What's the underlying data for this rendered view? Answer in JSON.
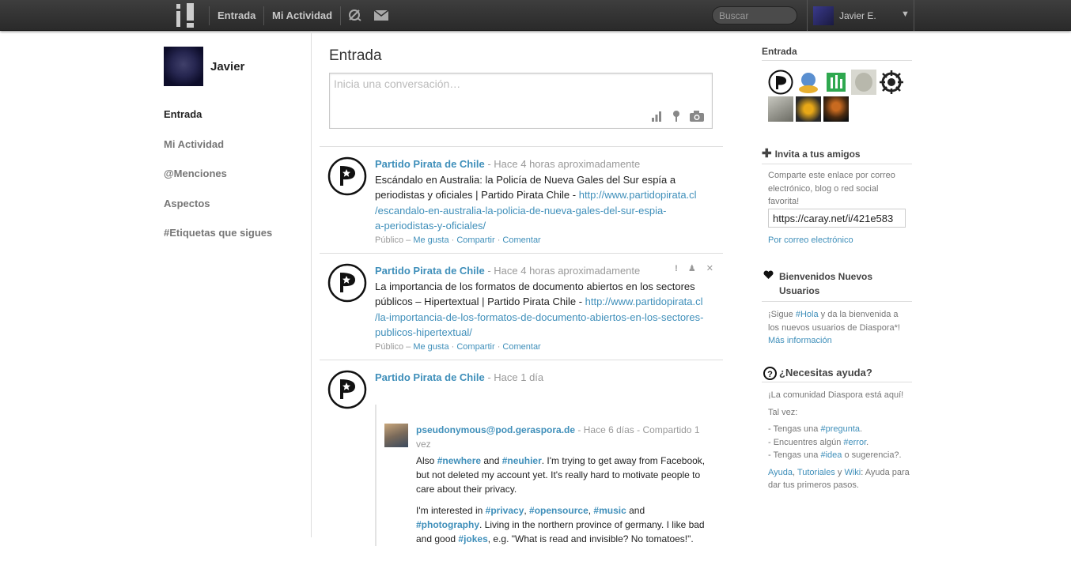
{
  "topbar": {
    "nav_home": "Entrada",
    "nav_activity": "Mi Actividad",
    "search_placeholder": "Buscar",
    "user_name": "Javier E."
  },
  "sidebar": {
    "name": "Javier",
    "items": [
      {
        "label": "Entrada",
        "active": true
      },
      {
        "label": "Mi Actividad"
      },
      {
        "label": "@Menciones"
      },
      {
        "label": "Aspectos"
      },
      {
        "label": "#Etiquetas que sigues"
      }
    ]
  },
  "main": {
    "title": "Entrada",
    "publisher_placeholder": "Inicia una conversación…",
    "posts": [
      {
        "author": "Partido Pirata de Chile",
        "time": "- Hace 4 horas aproximadamente",
        "text": "Escándalo en Australia: la Policía de Nueva Gales del Sur espía a periodistas y oficiales | Partido Pirata Chile - ",
        "link_l1": "http://www.partidopirata.cl",
        "link_l2": "/escandalo-en-australia-la-policia-de-nueva-gales-del-sur-espia-",
        "link_l3": "a-periodistas-y-oficiales/",
        "visibility": "Público",
        "like": "Me gusta",
        "share": "Compartir",
        "comment": "Comentar"
      },
      {
        "author": "Partido Pirata de Chile",
        "time": "- Hace 4 horas aproximadamente",
        "text": "La importancia de los formatos de documento abiertos en los sectores públicos – Hipertextual | Partido Pirata Chile - ",
        "link_l1": "http://www.partidopirata.cl",
        "link_l2": "/la-importancia-de-los-formatos-de-documento-abiertos-en-los-sectores-",
        "link_l3": "publicos-hipertextual/",
        "visibility": "Público",
        "like": "Me gusta",
        "share": "Compartir",
        "comment": "Comentar"
      },
      {
        "author": "Partido Pirata de Chile",
        "time": "- Hace 1 día",
        "reshare": {
          "author": "pseudonymous@pod.geraspora.de",
          "time": "- Hace 6 días - Compartido 1 vez",
          "p1_a": "Also ",
          "tag_newhere": "#newhere",
          "p1_b": " and ",
          "tag_neuhier": "#neuhier",
          "p1_c": ". I'm trying to get away from Facebook, but not deleted my account yet. It's really hard to motivate people to care about their privacy.",
          "p2_a": "I'm interested in ",
          "tag_privacy": "#privacy",
          "tag_opensource": "#opensource",
          "tag_music": "#music",
          "p2_and": " and ",
          "tag_photography": "#photography",
          "p2_b": ". Living in the northern province of germany. I like bad and good ",
          "tag_jokes": "#jokes",
          "p2_c": ", e.g. \"What is read and invisible? No tomatoes!\"."
        }
      }
    ]
  },
  "right": {
    "aspect_title": "Entrada",
    "invite_title": "Invita a tus amigos",
    "invite_text": "Comparte este enlace por correo electrónico, blog o red social favorita!",
    "invite_link": "https://caray.net/i/421e583",
    "invite_email": "Por correo electrónico",
    "welcome_title": "Bienvenidos Nuevos Usuarios",
    "welcome_a": "¡Sigue ",
    "welcome_tag": "#Hola",
    "welcome_b": " y da la bienvenida a los nuevos usuarios de Diaspora*!",
    "welcome_more": "Más información",
    "help_title": "¿Necesitas ayuda?",
    "help_l1": "¡La comunidad Diaspora está aquí!",
    "help_l2": "Tal vez:",
    "help_l3a": "- Tengas una ",
    "help_l3tag": "#pregunta",
    "help_l4a": "- Encuentres algún ",
    "help_l4tag": "#error",
    "help_l5a": "- Tengas una ",
    "help_l5tag": "#idea",
    "help_l5b": " o sugerencia?.",
    "help_ayuda": "Ayuda",
    "help_tutoriales": "Tutoriales",
    "help_y": " y ",
    "help_wiki": "Wiki",
    "help_end": ": Ayuda para dar tus primeros pasos."
  },
  "colors": {
    "link": "#3f8fba",
    "topbar": "#333333"
  }
}
